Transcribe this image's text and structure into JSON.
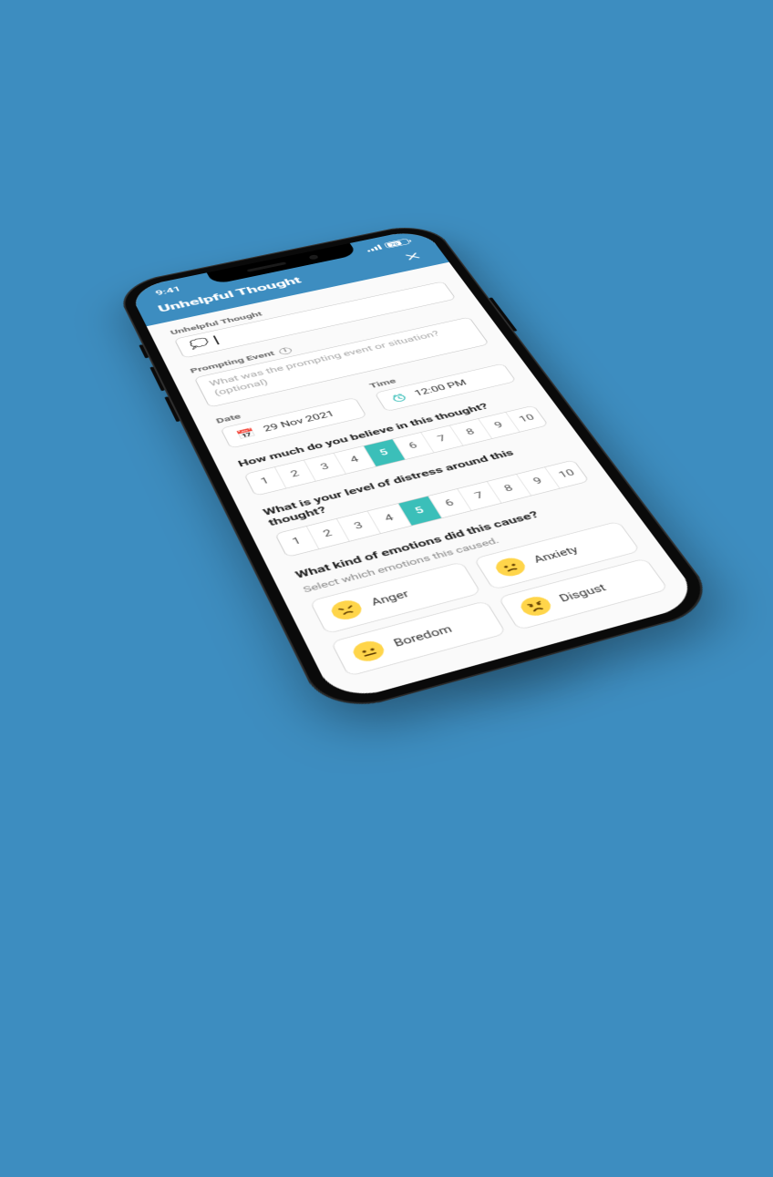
{
  "status": {
    "time": "9:41",
    "battery": "70"
  },
  "header": {
    "title": "Unhelpful Thought"
  },
  "form": {
    "thought": {
      "label": "Unhelpful Thought",
      "value": ""
    },
    "prompting": {
      "label": "Prompting Event",
      "placeholder": "What was the prompting event or situation? (optional)"
    },
    "date": {
      "label": "Date",
      "value": "29 Nov 2021"
    },
    "time": {
      "label": "Time",
      "value": "12:00 PM"
    },
    "belief": {
      "question": "How much do you believe in this thought?",
      "options": [
        "1",
        "2",
        "3",
        "4",
        "5",
        "6",
        "7",
        "8",
        "9",
        "10"
      ],
      "selected": "5"
    },
    "distress": {
      "question": "What is your level of distress around this thought?",
      "options": [
        "1",
        "2",
        "3",
        "4",
        "5",
        "6",
        "7",
        "8",
        "9",
        "10"
      ],
      "selected": "5"
    },
    "emotions": {
      "question": "What kind of emotions did this cause?",
      "sub": "Select which emotions this caused.",
      "items": [
        {
          "label": "Anger",
          "face": "anger"
        },
        {
          "label": "Anxiety",
          "face": "anxiety"
        },
        {
          "label": "Boredom",
          "face": "boredom"
        },
        {
          "label": "Disgust",
          "face": "disgust"
        }
      ]
    }
  },
  "colors": {
    "accent": "#3bbfb9",
    "brand": "#3d8dc0"
  }
}
